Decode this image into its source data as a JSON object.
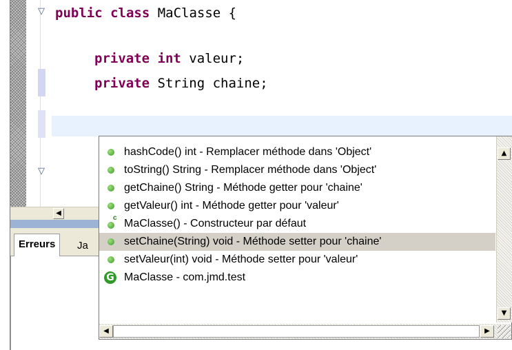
{
  "editor": {
    "line1": {
      "kw1": "public",
      "kw2": "class",
      "rest": " MaClasse {"
    },
    "line2": {
      "kw1": "private",
      "kw2": "int",
      "rest": " valeur;"
    },
    "line3": {
      "kw1": "private",
      "rest": " String chaine;"
    },
    "fold_marker": "▽"
  },
  "bottom_panel": {
    "tabs": [
      {
        "label": "Erreurs"
      },
      {
        "label": "Ja"
      }
    ]
  },
  "completion": {
    "selected_index": 5,
    "items": [
      {
        "icon": "method-icon",
        "label": "hashCode() int - Remplacer méthode dans 'Object'"
      },
      {
        "icon": "method-icon",
        "label": "toString() String - Remplacer méthode dans 'Object'"
      },
      {
        "icon": "method-icon",
        "label": "getChaine() String - Méthode getter pour 'chaine'"
      },
      {
        "icon": "method-icon",
        "label": "getValeur() int - Méthode getter pour 'valeur'"
      },
      {
        "icon": "constructor-icon",
        "label": "MaClasse() - Constructeur par défaut"
      },
      {
        "icon": "method-icon",
        "label": "setChaine(String) void - Méthode setter pour 'chaine'"
      },
      {
        "icon": "method-icon",
        "label": "setValeur(int) void - Méthode setter pour 'valeur'"
      },
      {
        "icon": "class-icon",
        "label": "MaClasse - com.jmd.test"
      }
    ]
  },
  "colors": {
    "keyword": "#7f0055",
    "selection": "#d4d0c8",
    "method_icon": "#3b9a2a"
  }
}
